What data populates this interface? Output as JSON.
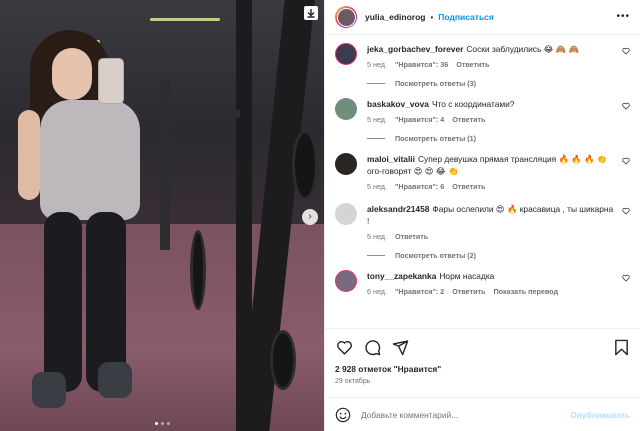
{
  "post": {
    "author": "yulia_edinorog",
    "follow_label": "Подписаться",
    "more_label": "•••"
  },
  "media": {
    "slide_count": 3,
    "active_slide": 1,
    "next_label": "›"
  },
  "comments": [
    {
      "username": "jeka_gorbachev_forever",
      "text": "Соски заблудились 😂 🙈 🙈",
      "time": "5 нед.",
      "likes": "\"Нравится\": 36",
      "reply": "Ответить",
      "replies_label": "Посмотреть ответы (3)",
      "avatar_color": "#3d3b4f"
    },
    {
      "username": "baskakov_vova",
      "text": "Что с координатами?",
      "time": "5 нед.",
      "likes": "\"Нравится\": 4",
      "reply": "Ответить",
      "replies_label": "Посмотреть ответы (1)",
      "avatar_color": "#6f8f7a"
    },
    {
      "username": "maloi_vitalii",
      "text": "Супер девушка прямая трансляция 🔥 🔥 🔥 👏 ого-говорят 😍 😍 😂 👏",
      "time": "5 нед.",
      "likes": "\"Нравится\": 6",
      "reply": "Ответить",
      "replies_label": "",
      "avatar_color": "#2a2422"
    },
    {
      "username": "aleksandr21458",
      "text": "Фары ослепили 😍 🔥 красавица , ты шикарна !",
      "time": "5 нед.",
      "likes": "",
      "reply": "Ответить",
      "replies_label": "Посмотреть ответы (2)",
      "avatar_color": "#c7c7c7"
    },
    {
      "username": "tony__zapekanka",
      "text": "Норм насадка",
      "time": "6 нед.",
      "likes": "\"Нравится\": 2",
      "reply": "Ответить",
      "translate": "Показать перевод",
      "replies_label": "",
      "avatar_color": "#7a6a80"
    }
  ],
  "actions": {
    "likes_count": "2 928 отметок \"Нравится\"",
    "date": "29 октябрь"
  },
  "add_comment": {
    "placeholder": "Добавьте комментарий...",
    "post_label": "Опубликовать"
  },
  "icons": [
    "download-icon",
    "more-icon",
    "heart-icon",
    "comment-icon",
    "share-icon",
    "save-icon",
    "emoji-icon"
  ],
  "colors": {
    "link": "#0095f6",
    "post_disabled": "#b2dffc",
    "meta": "#737373"
  }
}
